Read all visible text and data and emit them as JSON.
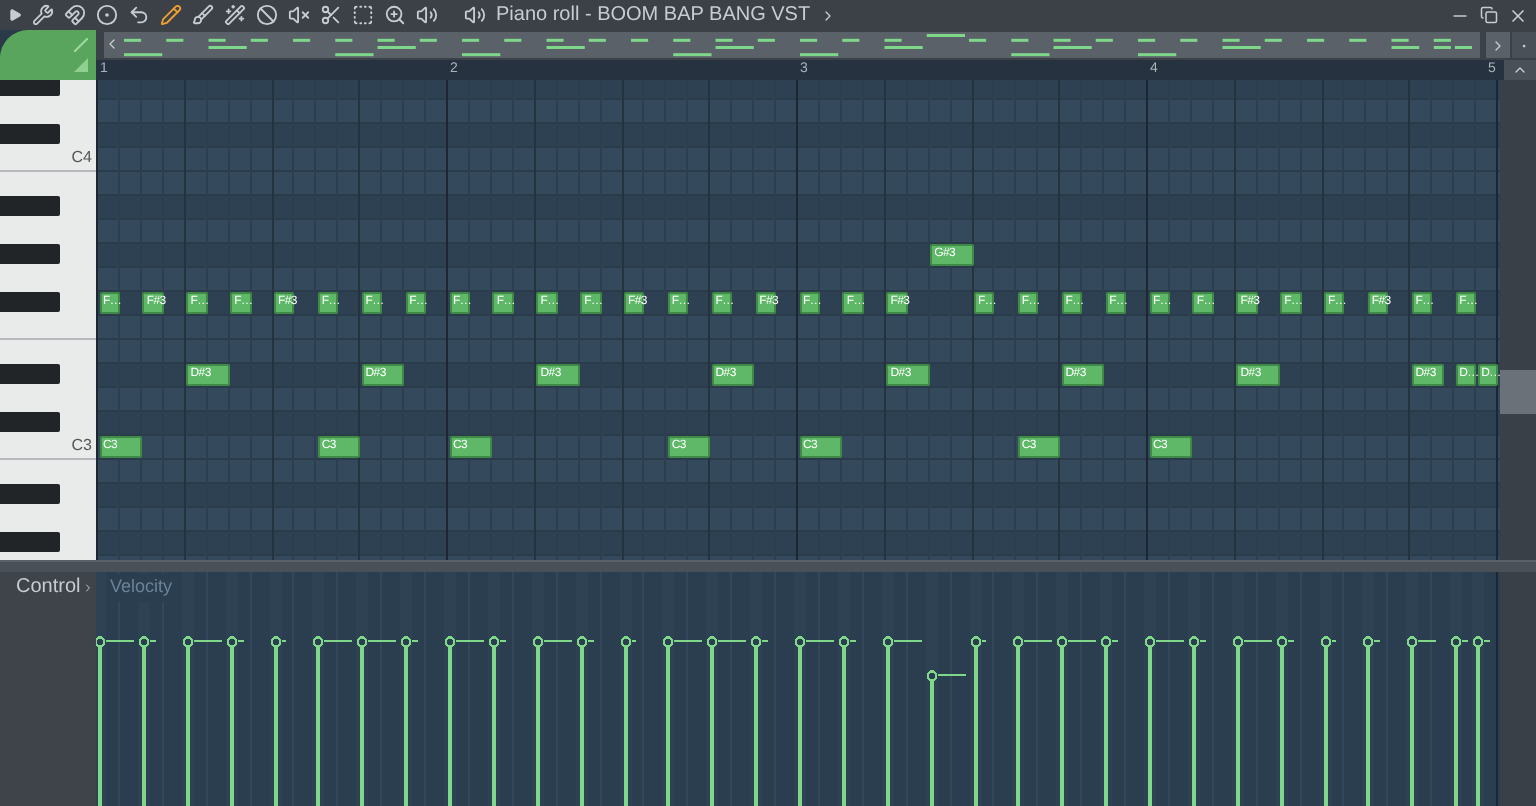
{
  "title_bar": {
    "title": "Piano roll - BOOM BAP BANG VST"
  },
  "ruler": {
    "bars": [
      "1",
      "2",
      "3",
      "4",
      "5"
    ]
  },
  "rows": [
    {
      "kind": "sharp"
    },
    {
      "kind": "natural"
    },
    {
      "kind": "sharp"
    },
    {
      "kind": "natural",
      "label": "C4"
    },
    {
      "kind": "natural"
    },
    {
      "kind": "sharp"
    },
    {
      "kind": "natural"
    },
    {
      "kind": "sharp",
      "notes": [
        {
          "kind": "bar_rest"
        },
        {
          "kind": "bar_rest"
        },
        {
          "kind": "beat_rest"
        },
        {
          "kind": "rest"
        },
        {
          "kind": "rest"
        },
        {
          "kind": "long",
          "label": "G#3",
          "level": 0.58
        }
      ]
    },
    {
      "kind": "natural"
    },
    {
      "kind": "sharp",
      "notes": [
        {
          "kind": "note",
          "label": "F…",
          "level": 0.73
        },
        {
          "kind": "rest"
        },
        {
          "kind": "note",
          "label": "F#3",
          "level": 0.73
        },
        {
          "kind": "rest"
        },
        {
          "kind": "note",
          "label": "F…",
          "level": 0.73
        },
        {
          "kind": "rest"
        },
        {
          "kind": "note",
          "label": "F…",
          "level": 0.73
        },
        {
          "kind": "rest"
        },
        {
          "kind": "note",
          "label": "F#3",
          "level": 0.73
        },
        {
          "kind": "rest"
        },
        {
          "kind": "note",
          "label": "F…",
          "level": 0.73
        },
        {
          "kind": "rest"
        },
        {
          "kind": "note",
          "label": "F…",
          "level": 0.73
        },
        {
          "kind": "rest"
        },
        {
          "kind": "note",
          "label": "F…",
          "level": 0.73
        },
        {
          "kind": "rest"
        },
        {
          "kind": "note",
          "label": "F…",
          "level": 0.73
        },
        {
          "kind": "rest"
        },
        {
          "kind": "note",
          "label": "F…",
          "level": 0.73
        },
        {
          "kind": "rest"
        },
        {
          "kind": "note",
          "label": "F…",
          "level": 0.73
        },
        {
          "kind": "rest"
        },
        {
          "kind": "note",
          "label": "F…",
          "level": 0.73
        },
        {
          "kind": "rest"
        },
        {
          "kind": "note",
          "label": "F#3",
          "level": 0.73
        },
        {
          "kind": "rest"
        },
        {
          "kind": "note",
          "label": "F…",
          "level": 0.73
        },
        {
          "kind": "rest"
        },
        {
          "kind": "note",
          "label": "F…",
          "level": 0.73
        },
        {
          "kind": "rest"
        },
        {
          "kind": "note",
          "label": "F#3",
          "level": 0.73
        },
        {
          "kind": "rest"
        },
        {
          "kind": "note",
          "label": "F…",
          "level": 0.73
        },
        {
          "kind": "rest"
        },
        {
          "kind": "note",
          "label": "F…",
          "level": 0.73
        },
        {
          "kind": "rest"
        },
        {
          "kind": "note",
          "label": "F#3",
          "level": 0.73
        },
        {
          "kind": "rest"
        },
        {
          "kind": "rest"
        },
        {
          "kind": "rest"
        },
        {
          "kind": "note",
          "label": "F…",
          "level": 0.73
        },
        {
          "kind": "rest"
        },
        {
          "kind": "note",
          "label": "F…",
          "level": 0.73
        },
        {
          "kind": "rest"
        },
        {
          "kind": "note",
          "label": "F…",
          "level": 0.73
        },
        {
          "kind": "rest"
        },
        {
          "kind": "note",
          "label": "F…",
          "level": 0.73
        },
        {
          "kind": "rest"
        },
        {
          "kind": "note",
          "label": "F…",
          "level": 0.73
        },
        {
          "kind": "rest"
        },
        {
          "kind": "note",
          "label": "F…",
          "level": 0.73
        },
        {
          "kind": "rest"
        },
        {
          "kind": "note",
          "label": "F#3",
          "level": 0.73
        },
        {
          "kind": "rest"
        },
        {
          "kind": "note",
          "label": "F…",
          "level": 0.73
        },
        {
          "kind": "rest"
        },
        {
          "kind": "note",
          "label": "F…",
          "level": 0.73
        },
        {
          "kind": "rest"
        },
        {
          "kind": "note",
          "label": "F#3",
          "level": 0.73
        },
        {
          "kind": "rest"
        },
        {
          "kind": "note",
          "label": "F…",
          "level": 0.73
        },
        {
          "kind": "rest"
        },
        {
          "kind": "note",
          "label": "F…",
          "level": 0.73
        }
      ]
    },
    {
      "kind": "natural"
    },
    {
      "kind": "natural"
    },
    {
      "kind": "sharp",
      "notes": [
        {
          "kind": "beat_rest"
        },
        {
          "kind": "long",
          "label": "D#3",
          "level": 0.73
        },
        {
          "kind": "beat_rest"
        },
        {
          "kind": "rest"
        },
        {
          "kind": "rest"
        },
        {
          "kind": "long",
          "label": "D#3",
          "level": 0.73
        },
        {
          "kind": "beat_rest"
        },
        {
          "kind": "rest"
        },
        {
          "kind": "rest"
        },
        {
          "kind": "long",
          "label": "D#3",
          "level": 0.73
        },
        {
          "kind": "beat_rest"
        },
        {
          "kind": "rest"
        },
        {
          "kind": "rest"
        },
        {
          "kind": "long",
          "label": "D#3",
          "level": 0.73
        },
        {
          "kind": "beat_rest"
        },
        {
          "kind": "rest"
        },
        {
          "kind": "rest"
        },
        {
          "kind": "long",
          "label": "D#3",
          "level": 0.73
        },
        {
          "kind": "beat_rest"
        },
        {
          "kind": "rest"
        },
        {
          "kind": "rest"
        },
        {
          "kind": "long",
          "label": "D#3",
          "level": 0.73
        },
        {
          "kind": "beat_rest"
        },
        {
          "kind": "rest"
        },
        {
          "kind": "rest"
        },
        {
          "kind": "long",
          "label": "D#3",
          "level": 0.73
        },
        {
          "kind": "beat_rest"
        },
        {
          "kind": "rest"
        },
        {
          "kind": "rest"
        },
        {
          "kind": "dotted",
          "label": "D#3",
          "level": 0.73
        },
        {
          "kind": "half_rest"
        },
        {
          "kind": "note",
          "label": "D…",
          "level": 0.73
        },
        {
          "kind": "note",
          "label": "D…",
          "level": 0.73
        }
      ]
    },
    {
      "kind": "natural"
    },
    {
      "kind": "sharp"
    },
    {
      "kind": "natural",
      "label": "C3",
      "notes": [
        {
          "kind": "long",
          "label": "C3",
          "level": 0.73
        },
        {
          "kind": "beat_rest"
        },
        {
          "kind": "beat_rest"
        },
        {
          "kind": "long",
          "label": "C3",
          "level": 0.73
        },
        {
          "kind": "beat_rest"
        },
        {
          "kind": "long",
          "label": "C3",
          "level": 0.73
        },
        {
          "kind": "beat_rest"
        },
        {
          "kind": "beat_rest"
        },
        {
          "kind": "long",
          "label": "C3",
          "level": 0.73
        },
        {
          "kind": "beat_rest"
        },
        {
          "kind": "long",
          "label": "C3",
          "level": 0.73
        },
        {
          "kind": "beat_rest"
        },
        {
          "kind": "beat_rest"
        },
        {
          "kind": "long",
          "label": "C3",
          "level": 0.73
        },
        {
          "kind": "beat_rest"
        },
        {
          "kind": "long",
          "label": "C3",
          "level": 0.73
        }
      ]
    },
    {
      "kind": "natural"
    },
    {
      "kind": "sharp"
    },
    {
      "kind": "natural"
    },
    {
      "kind": "sharp"
    },
    {
      "kind": "natural"
    }
  ],
  "control": {
    "label": "Control",
    "lane": "Velocity"
  }
}
